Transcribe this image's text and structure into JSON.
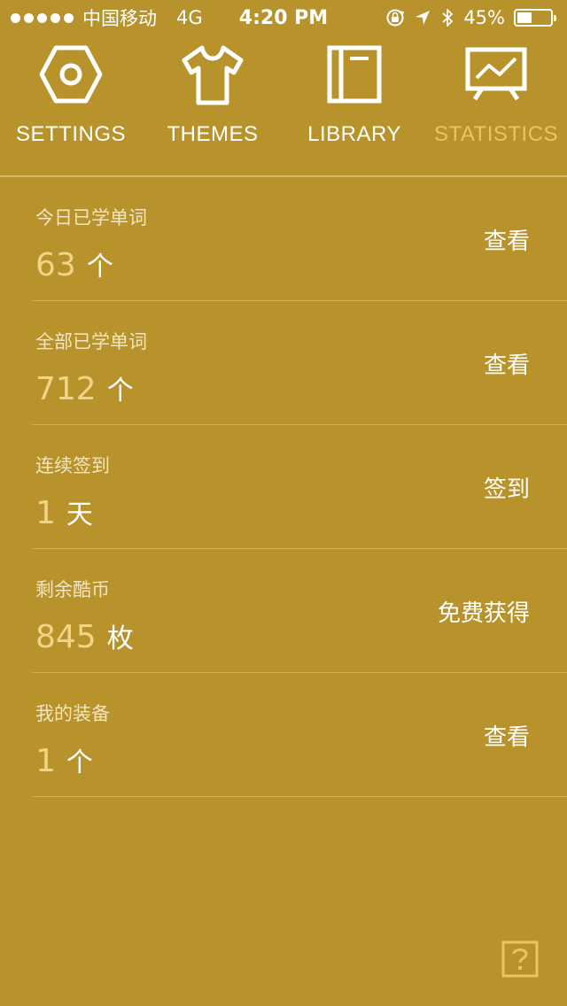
{
  "status_bar": {
    "carrier": "中国移动",
    "network": "4G",
    "time": "4:20 PM",
    "battery_percent": "45%",
    "battery_level": 0.45,
    "signal_icon": "signal-dots-icon",
    "icons": [
      "rotation-lock-icon",
      "location-arrow-icon",
      "bluetooth-icon",
      "battery-icon"
    ]
  },
  "tabs": [
    {
      "label": "SETTINGS",
      "icon": "hexagon-nut-icon",
      "active": false
    },
    {
      "label": "THEMES",
      "icon": "tshirt-icon",
      "active": false
    },
    {
      "label": "LIBRARY",
      "icon": "book-icon",
      "active": false
    },
    {
      "label": "STATISTICS",
      "icon": "chart-monitor-icon",
      "active": true
    }
  ],
  "stats": [
    {
      "label": "今日已学单词",
      "value": "63",
      "unit": "个",
      "action": "查看"
    },
    {
      "label": "全部已学单词",
      "value": "712",
      "unit": "个",
      "action": "查看"
    },
    {
      "label": "连续签到",
      "value": "1",
      "unit": "天",
      "action": "签到"
    },
    {
      "label": "剩余酷币",
      "value": "845",
      "unit": "枚",
      "action": "免费获得"
    },
    {
      "label": "我的装备",
      "value": "1",
      "unit": "个",
      "action": "查看"
    }
  ],
  "help": {
    "icon": "help-question-icon"
  },
  "colors": {
    "background": "#b8922a",
    "active_tab": "#e8c465",
    "number": "#f0d488",
    "label": "#f1e5c2",
    "divider": "#cfae55"
  }
}
